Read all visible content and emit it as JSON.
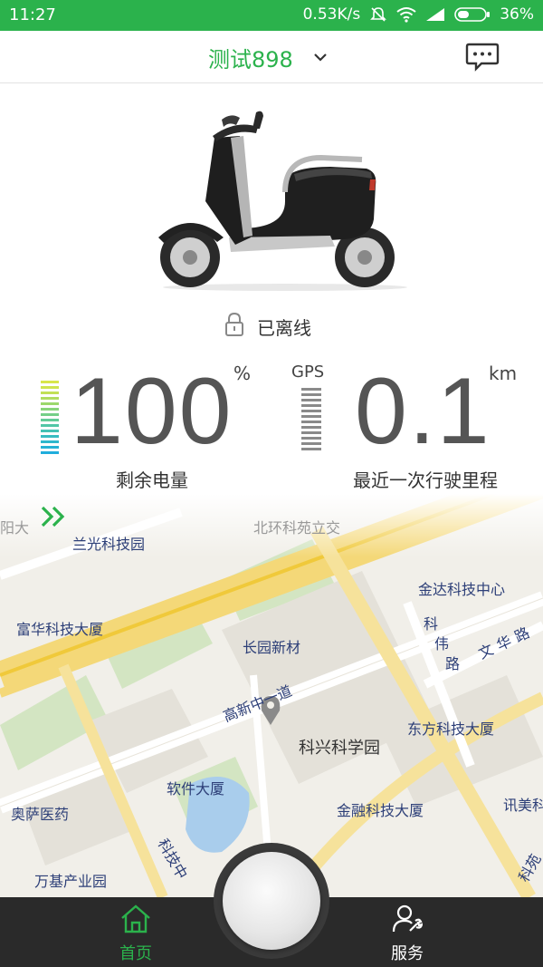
{
  "status_bar": {
    "time": "11:27",
    "net_speed": "0.53K/s",
    "battery": "36%"
  },
  "header": {
    "title": "测试898",
    "dropdown_icon": "chevron-down-icon",
    "message_icon": "chat-bubble-icon"
  },
  "vehicle": {
    "status_icon": "lock-icon",
    "status": "已离线"
  },
  "battery": {
    "value": "100",
    "unit": "%",
    "label": "剩余电量",
    "level_fraction": 1.0
  },
  "gps": {
    "label": "GPS"
  },
  "trip": {
    "value": "0.1",
    "unit": "km",
    "label": "最近一次行驶里程"
  },
  "map": {
    "labels": [
      "阳大",
      "兰光科技园",
      "北环科苑立交",
      "金达科技中心",
      "富华科技大厦",
      "长园新材",
      "科",
      "伟",
      "路",
      "文华路",
      "高新中一道",
      "东方科技大厦",
      "科兴科学园",
      "软件大厦",
      "奥萨医药",
      "金融科技大厦",
      "讯美科",
      "科技中",
      "万基产业园",
      "科苑"
    ]
  },
  "nav": {
    "home_label": "首页",
    "service_label": "服务"
  },
  "colors": {
    "brand_green": "#2bb24c",
    "nav_bg": "#2a2a2a"
  }
}
